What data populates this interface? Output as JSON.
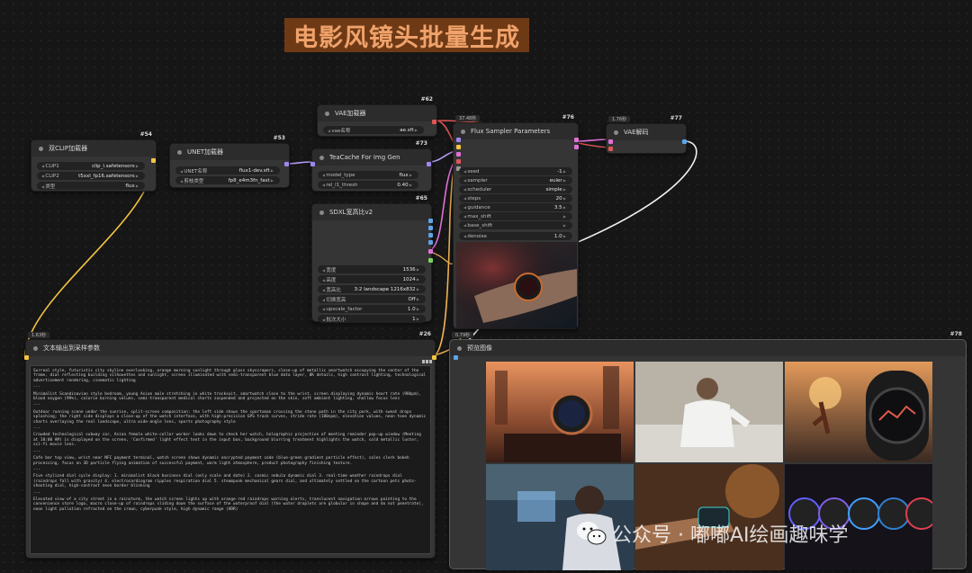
{
  "canvas_title": "电影风镜头批量生成",
  "nodes": {
    "dual_clip": {
      "id": "#54",
      "title": "双CLIP加载器",
      "widgets": [
        {
          "label": "CLIP1",
          "value": "clip_l.safetensors"
        },
        {
          "label": "CLIP2",
          "value": "t5xxl_fp16.safetensors"
        },
        {
          "label": "类型",
          "value": "flux"
        }
      ]
    },
    "unet": {
      "id": "#53",
      "title": "UNET加载器",
      "widgets": [
        {
          "label": "UNET名称",
          "value": "flux1-dev.sft"
        },
        {
          "label": "剪枝类型",
          "value": "fp8_e4m3fn_fast"
        }
      ]
    },
    "vae_loader": {
      "id": "#62",
      "title": "VAE加载器",
      "widgets": [
        {
          "label": "vae名称",
          "value": "ae.sft"
        }
      ]
    },
    "teacache": {
      "id": "#73",
      "title": "TeaCache For Img Gen",
      "widgets": [
        {
          "label": "model_type",
          "value": "flux"
        },
        {
          "label": "rel_l1_thresh",
          "value": "0.40"
        }
      ]
    },
    "sdxl_res": {
      "id": "#65",
      "title": "SDXL宽高比v2",
      "widgets": [
        {
          "label": "宽度",
          "value": "1536"
        },
        {
          "label": "高度",
          "value": "1024"
        },
        {
          "label": "宽高比",
          "value": "3:2 landscape 1216x832"
        },
        {
          "label": "切换宽高",
          "value": "Off"
        },
        {
          "label": "upscale_factor",
          "value": "1.0"
        },
        {
          "label": "批次大小",
          "value": "1"
        }
      ]
    },
    "flux_sampler": {
      "id": "#76",
      "group_tag": "37.48秒",
      "title": "Flux Sampler Parameters",
      "widgets": [
        {
          "label": "seed",
          "value": "-1"
        },
        {
          "label": "sampler",
          "value": "euler"
        },
        {
          "label": "scheduler",
          "value": "simple"
        },
        {
          "label": "steps",
          "value": "20"
        },
        {
          "label": "guidance",
          "value": "3.5"
        },
        {
          "label": "max_shift",
          "value": ""
        },
        {
          "label": "base_shift",
          "value": ""
        },
        {
          "label": "denoise",
          "value": "1.0"
        }
      ]
    },
    "vae_decode": {
      "id": "#77",
      "group_tag": "1.76秒",
      "title": "VAE解码"
    },
    "text_batch": {
      "id": "#26",
      "group_tag": "1.63秒",
      "title": "文本输出到采样参数",
      "prompts": [
        "Surreal style, futuristic city skyline overlooking, orange morning sunlight through glass skyscrapers, close-up of metallic smartwatch occupying the center of the frame, dial reflecting building silhouettes and sunlight, screen illuminated with semi-transparent blue data layer, 8K details, high contrast lighting, technological advertisement rendering, cinematic lighting",
        "---",
        "Minimalist Scandinavian style bedroom, young Asian male stretching in white tracksuit, smartwatch close to the wrist, screen displaying dynamic heart rate (98bpm), blood oxygen (99%), calorie burning values, semi-transparent medical charts suspended and projected on the skin, soft ambient lighting, shallow focus lens",
        "---",
        "Outdoor running scene under the sunrise, split-screen composition: the left side shows the sportsman crossing the stone path in the city park, with sweat drops splashing; the right side displays a close-up of the watch interface, with high-precision GPS track curves, stride rate (180spm), elevation values, neon tone dynamic charts overlaying the real landscape, ultra wide-angle lens, sports photography style",
        "---",
        "Crowded technological subway car, Asian female white-collar worker looks down to check her watch, holographic projection of meeting reminder pop-up window (Meeting at 10:00 AM) is displayed on the screen, 'Confirmed' light effect text in the input box, background blurring treatment highlights the watch, cold metallic luster, sci-fi movie lens.",
        "---",
        "Cafe bar top view, wrist near NFC payment terminal, watch screen shows dynamic encrypted payment code (blue-green gradient particle effect), sales clerk bokeh processing, focus on 3D particle flying animation of successful payment, warm light atmosphere, product photography finishing texture.",
        "---",
        "Five stylized dial cycle display: 1. minimalist black business dial (only scale and date) 2. cosmic nebula dynamic dial 3. real-time weather raindrops dial (raindrops fall with gravity) 4. electrocardiogram ripples respiration dial 5. steampunk mechanical gears dial, and ultimately settled on the cartoon pets photo-shooting dial, high-contrast neon border blinking",
        "---",
        "Elevated view of a city street in a rainstorm, the watch screen lights up with orange-red raindrops warning alerts, translucent navigation arrows pointing to the convenience store logo, macro close-up of raindrops sliding down the surface of the waterproof dial (the water droplets are globular in shape and do not penetrate), neon light pollution refracted on the crown, cyberpunk style, high dynamic range (HDR)"
      ]
    },
    "preview": {
      "id": "#78",
      "group_tag": "0.79秒",
      "title": "预览图像"
    }
  },
  "watermark": {
    "text": "公众号 · 嘟嘟AI绘画趣味学",
    "icon": "wechat-icon"
  },
  "colors": {
    "clip_wire": "#f5c542",
    "model_wire": "#b69cf5",
    "vae_wire": "#e05555",
    "latent_wire": "#e070d6",
    "image_wire": "#f0f0f0",
    "string_wire": "#f5b552",
    "title_banner_bg": "#6e3a16",
    "title_banner_text": "#f0a26a"
  }
}
